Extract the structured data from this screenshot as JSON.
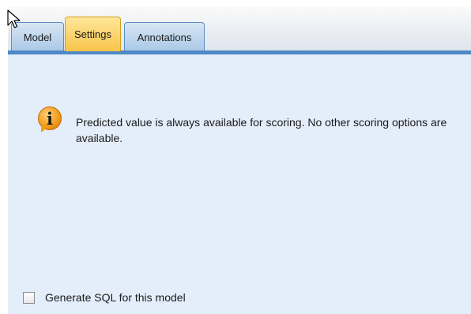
{
  "tabs": [
    {
      "label": "Model",
      "selected": false
    },
    {
      "label": "Settings",
      "selected": true
    },
    {
      "label": "Annotations",
      "selected": false
    }
  ],
  "info": {
    "icon": "info-icon",
    "glyph": "i",
    "message": "Predicted value is always available for scoring. No other scoring options are available."
  },
  "options": {
    "generate_sql_label": "Generate SQL for this model",
    "generate_sql_checked": false
  },
  "colors": {
    "active_tab": "#f8c44a",
    "inactive_tab": "#a9c8e6",
    "accent_bar": "#4f88c6",
    "panel_bg": "#e4eefa"
  }
}
